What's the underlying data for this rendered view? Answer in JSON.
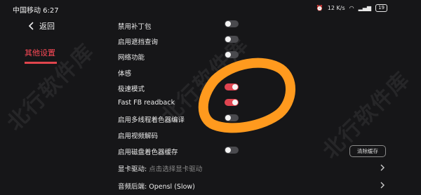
{
  "status": {
    "carrier_time": "中国移动 6:27",
    "net_speed": "12 K/s",
    "battery": "19"
  },
  "nav": {
    "back_label": "返回"
  },
  "sidebar": {
    "active_item": "其他设置"
  },
  "settings": {
    "disable_patch": "禁用补丁包",
    "occlusion_query": "启用遮挡查询",
    "network": "网络功能",
    "motion": "体感",
    "turbo_mode": "极速模式",
    "fast_fb": "Fast FB readback",
    "mt_shader": "启用多线程着色器编译",
    "video_decode": "启用视频解码",
    "disk_shader_cache": "启用磁盘着色器缓存",
    "gpu_driver_label": "显卡驱动:",
    "gpu_driver_hint": "点击选择显卡驱动",
    "audio_backend": "音频后端: Opensl (Slow)"
  },
  "toggles": {
    "disable_patch": false,
    "occlusion_query": false,
    "network": false,
    "turbo_mode": true,
    "fast_fb": true,
    "mt_shader": false,
    "disk_shader_cache": false
  },
  "buttons": {
    "clear_cache": "清除缓存"
  },
  "watermark": "北行软件库",
  "colors": {
    "accent": "#e04450",
    "annotation": "#ff9a1e",
    "background": "#161618"
  }
}
